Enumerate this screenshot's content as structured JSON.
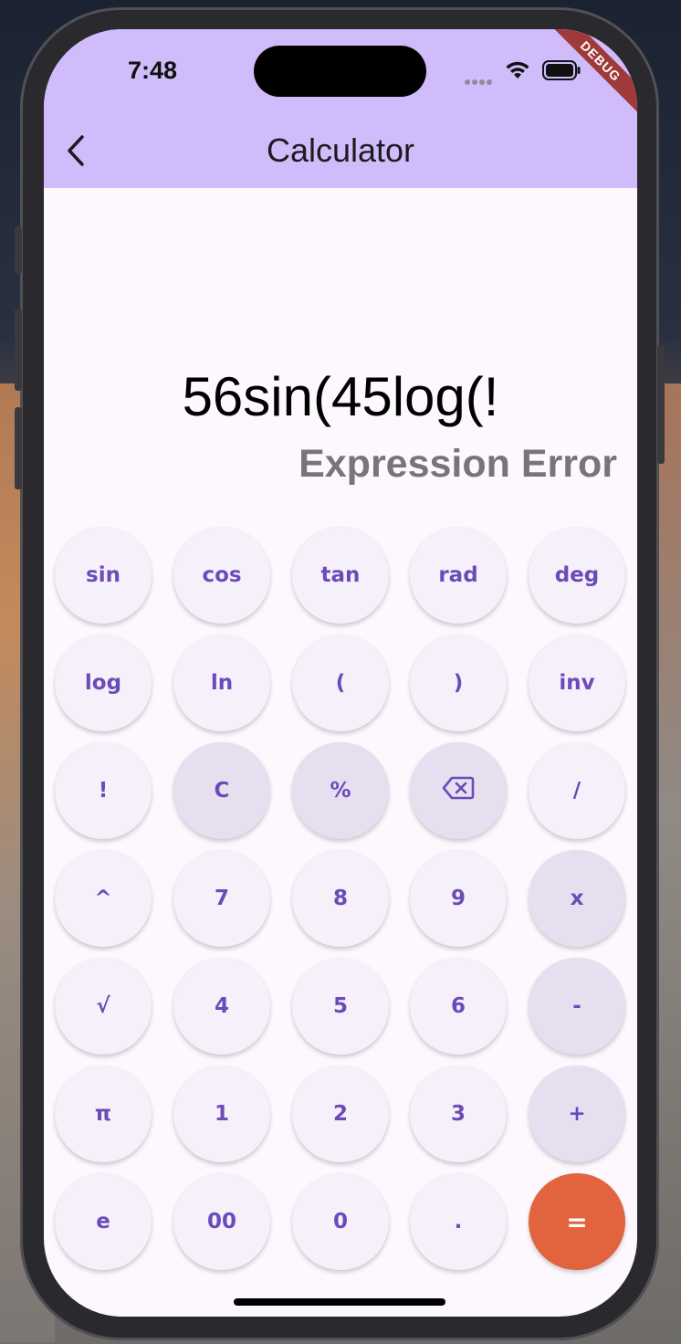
{
  "status": {
    "time": "7:48",
    "debug_label": "DEBUG"
  },
  "appbar": {
    "title": "Calculator",
    "back_icon": "chevron-left-icon"
  },
  "display": {
    "expression": "56sin(45log(!",
    "result": "Expression Error"
  },
  "keys": [
    [
      "sin",
      "cos",
      "tan",
      "rad",
      "deg"
    ],
    [
      "log",
      "ln",
      "(",
      ")",
      "inv"
    ],
    [
      "!",
      "C",
      "%",
      "⌫",
      "/"
    ],
    [
      "^",
      "7",
      "8",
      "9",
      "x"
    ],
    [
      "√",
      "4",
      "5",
      "6",
      "-"
    ],
    [
      "π",
      "1",
      "2",
      "3",
      "+"
    ],
    [
      "e",
      "00",
      "0",
      ".",
      "="
    ]
  ],
  "colors": {
    "appbar": "#d0bcfb",
    "key_light": "#f6f0fb",
    "key_dark": "#e6dff0",
    "equals": "#e2643e",
    "key_text": "#6b4bb8"
  }
}
